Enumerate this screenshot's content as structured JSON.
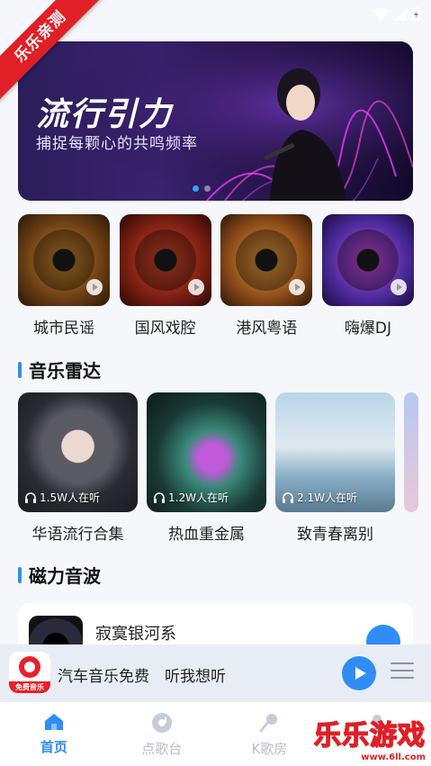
{
  "watermark": {
    "corner_ribbon": "乐乐亲测",
    "brand": "乐乐游戏",
    "url": "www.6ll.com"
  },
  "banner": {
    "title": "流行引力",
    "subtitle": "捕捉每颗心的共鸣频率"
  },
  "categories": [
    {
      "label": "城市民谣"
    },
    {
      "label": "国风戏腔"
    },
    {
      "label": "港风粤语"
    },
    {
      "label": "嗨爆DJ"
    }
  ],
  "radar": {
    "title": "音乐雷达",
    "playlists": [
      {
        "name": "华语流行合集",
        "listeners": "1.5W人在听"
      },
      {
        "name": "热血重金属",
        "listeners": "1.2W人在听"
      },
      {
        "name": "致青春离别",
        "listeners": "2.1W人在听"
      }
    ]
  },
  "magnetic": {
    "title": "磁力音波",
    "songs": [
      {
        "title": "寂寞银河系"
      }
    ]
  },
  "mini_player": {
    "logo_caption": "免费音乐",
    "now_playing": "汽车音乐免费　听我想听"
  },
  "nav": {
    "tabs": [
      {
        "label": "首页",
        "icon": "home-icon",
        "active": true
      },
      {
        "label": "点歌台",
        "icon": "disc-icon",
        "active": false
      },
      {
        "label": "K歌房",
        "icon": "microphone-icon",
        "active": false
      },
      {
        "label": "",
        "icon": "profile-icon",
        "active": false
      }
    ]
  },
  "colors": {
    "accent": "#2f8df5",
    "ribbon": "#e01f26"
  }
}
